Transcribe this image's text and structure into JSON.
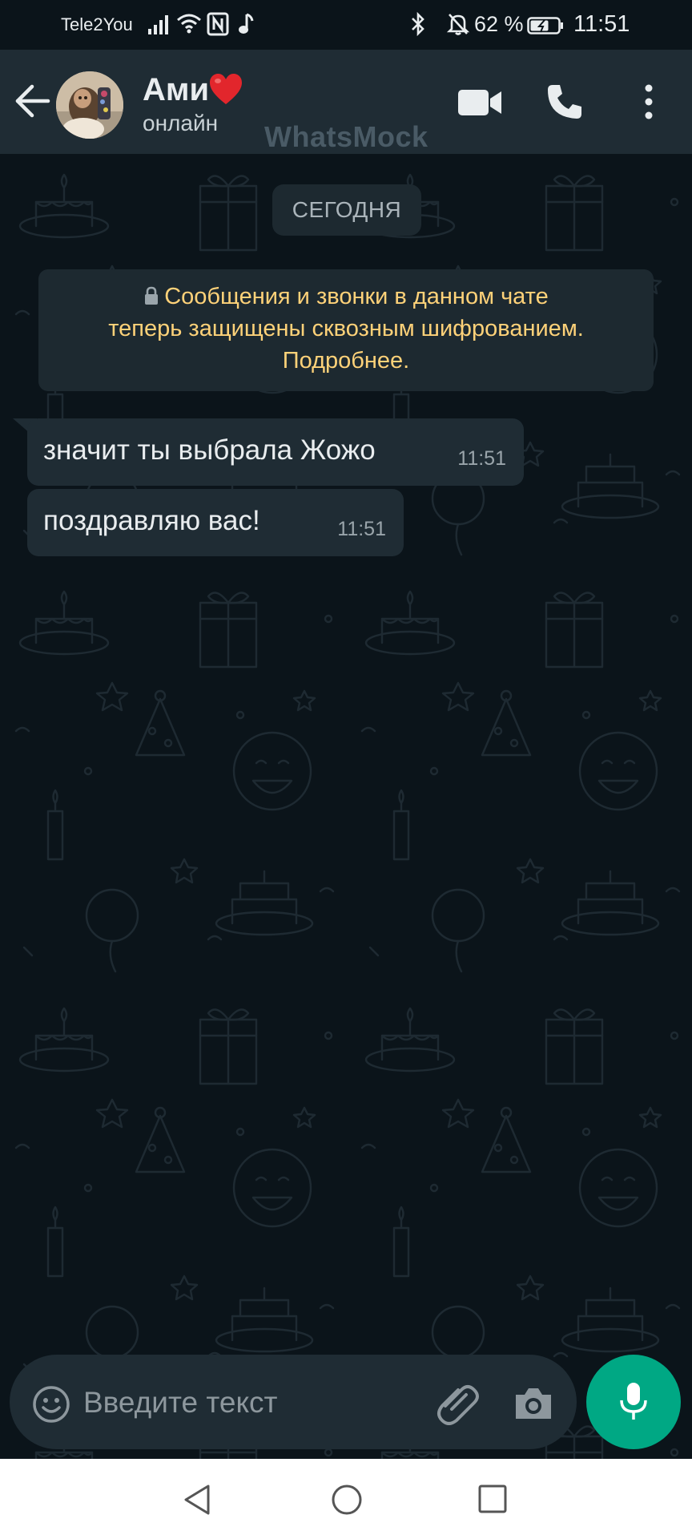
{
  "status_bar": {
    "carrier": "Tele2You",
    "battery": "62 %",
    "time": "11:51",
    "icons": [
      "signal-icon",
      "wifi-icon",
      "nfc-icon",
      "music-icon",
      "bluetooth-icon",
      "bell-off-icon",
      "battery-icon"
    ]
  },
  "header": {
    "contact_name": "Ами",
    "contact_status": "онлайн",
    "watermark": "WhatsMock",
    "icons": [
      "back-arrow-icon",
      "video-call-icon",
      "phone-icon",
      "more-vert-icon"
    ]
  },
  "chat": {
    "date_chip": "СЕГОДНЯ",
    "encryption_notice": {
      "line1": "Сообщения и звонки в данном чате",
      "line2": "теперь защищены сквозным шифрованием.",
      "line3": "Подробнее."
    },
    "messages": [
      {
        "text": "значит ты выбрала Жожо",
        "time": "11:51"
      },
      {
        "text": "поздравляю вас!",
        "time": "11:51"
      }
    ]
  },
  "composer": {
    "placeholder": "Введите текст",
    "icons": [
      "emoji-icon",
      "attach-icon",
      "camera-icon",
      "mic-icon"
    ]
  },
  "colors": {
    "background": "#0b141a",
    "header": "#1f2c34",
    "bubble": "#1f2c34",
    "notice_text": "#ffd279",
    "accent": "#00a884",
    "heart": "#e2262c"
  }
}
